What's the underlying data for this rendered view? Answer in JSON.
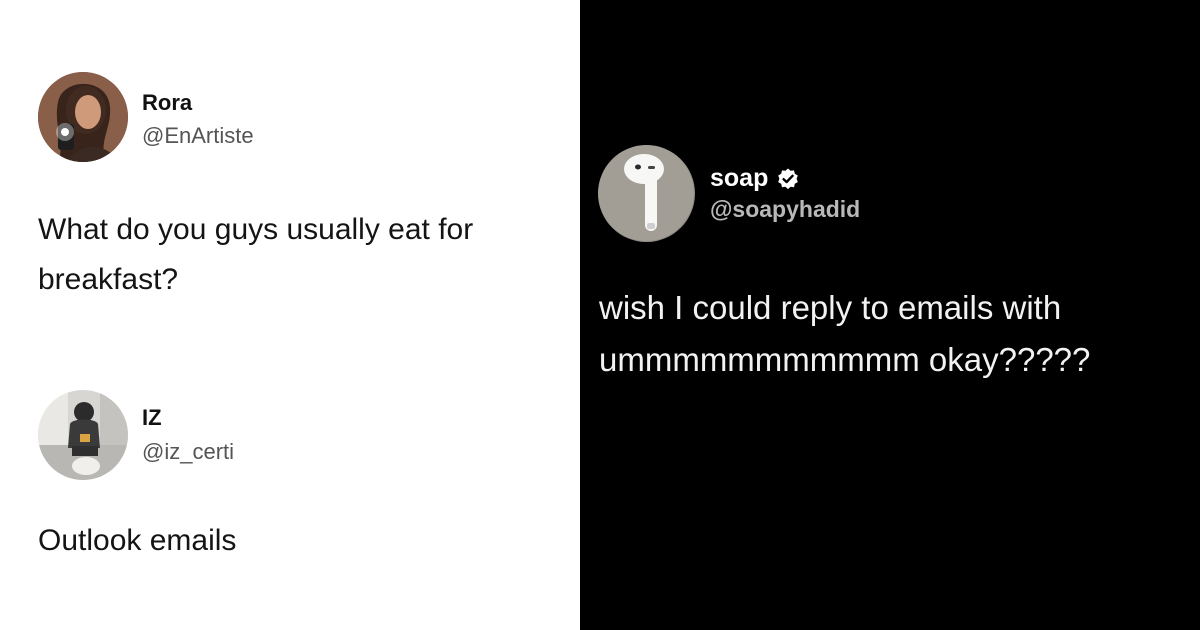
{
  "tweets": [
    {
      "name": "Rora",
      "handle": "@EnArtiste",
      "text": "What do you guys usually eat for breakfast?",
      "avatar_icon": "person-selfie-avatar"
    },
    {
      "name": "IZ",
      "handle": "@iz_certi",
      "text": "Outlook emails",
      "avatar_icon": "person-sitting-avatar"
    },
    {
      "name": "soap",
      "handle": "@soapyhadid",
      "text": "wish I could reply to emails with ummmmmmmmmmm okay?????",
      "verified": true,
      "avatar_icon": "airpod-avatar"
    }
  ],
  "colors": {
    "light_bg": "#ffffff",
    "dark_bg": "#000000",
    "light_text": "#141414",
    "dark_text": "#f2f2f2",
    "handle_gray": "#4a4a4a"
  }
}
